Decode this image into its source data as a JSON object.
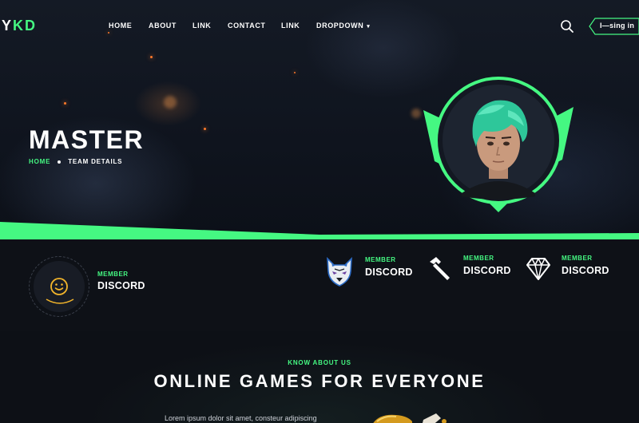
{
  "header": {
    "logo_left": "Y",
    "logo_right": "KD",
    "nav": [
      {
        "label": "HOME"
      },
      {
        "label": "ABOUT"
      },
      {
        "label": "LINK"
      },
      {
        "label": "CONTACT"
      },
      {
        "label": "LINK"
      },
      {
        "label": "DROPDOWN"
      }
    ],
    "search_icon": "search-icon",
    "signin_label": "I—sing in"
  },
  "hero": {
    "title": "MASTER",
    "breadcrumb": {
      "home": "HOME",
      "current": "TEAM DETAILS"
    }
  },
  "stats": {
    "primary": {
      "label": "MEMBER",
      "value": "DISCORD",
      "icon": "smiley-icon"
    },
    "items": [
      {
        "label": "MEMBER",
        "value": "DISCORD",
        "icon": "wolf-icon"
      },
      {
        "label": "MEMBER",
        "value": "DISCORD",
        "icon": "hammer-icon"
      },
      {
        "label": "MEMBER",
        "value": "DISCORD",
        "icon": "diamond-icon"
      }
    ]
  },
  "about": {
    "kicker": "KNOW ABOUT US",
    "title": "ONLINE GAMES FOR EVERYONE",
    "text": "Lorem ipsum dolor sit amet, consteur adipiscing"
  },
  "colors": {
    "accent": "#45f882",
    "background": "#0d1016"
  }
}
